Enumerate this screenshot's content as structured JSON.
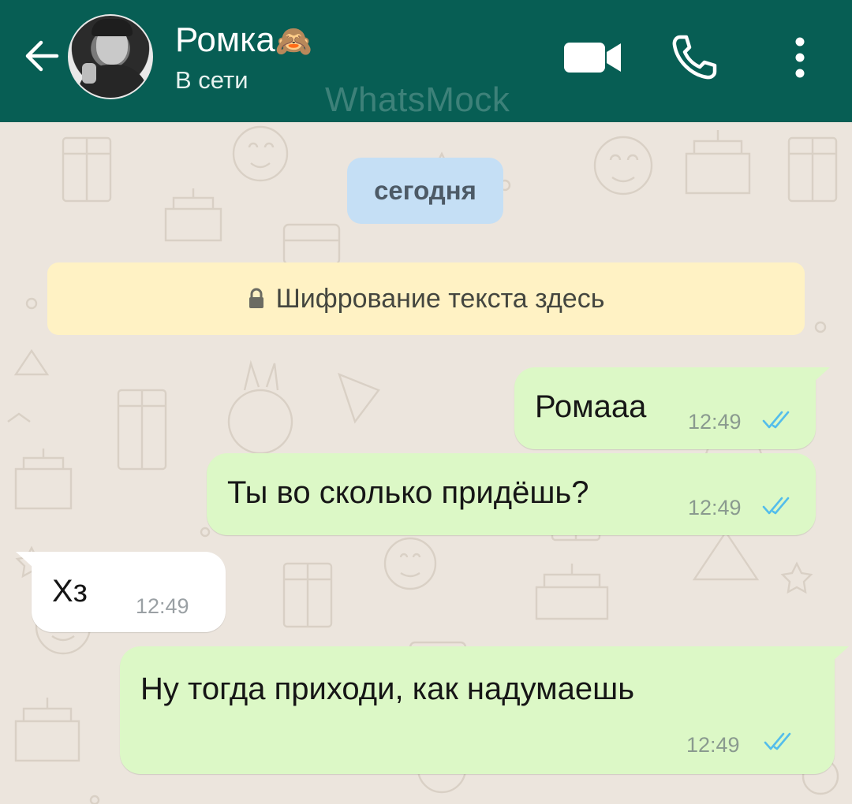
{
  "header": {
    "contact_name": "Ромка",
    "contact_emoji": "🙈",
    "status": "В сети",
    "watermark": "WhatsMock",
    "back_icon": "arrow-left-icon",
    "video_icon": "video-camera-icon",
    "call_icon": "phone-icon",
    "menu_icon": "more-vertical-icon"
  },
  "chat": {
    "date_divider": "сегодня",
    "encryption_notice": "Шифрование текста здесь",
    "messages": [
      {
        "direction": "outgoing",
        "text": "Ромааа",
        "time": "12:49",
        "status": "read"
      },
      {
        "direction": "outgoing",
        "text": "Ты во сколько придёшь?",
        "time": "12:49",
        "status": "read"
      },
      {
        "direction": "incoming",
        "text": "Хз",
        "time": "12:49"
      },
      {
        "direction": "outgoing",
        "text": "Ну тогда приходи, как надумаешь",
        "time": "12:49",
        "status": "read"
      }
    ]
  },
  "colors": {
    "header_bg": "#075e54",
    "chat_bg": "#ece5dd",
    "outgoing_bubble": "#dcf8c6",
    "incoming_bubble": "#ffffff",
    "read_ticks": "#53bdeb",
    "date_chip": "#c5dff5",
    "encryption_bg": "#fff2c4"
  }
}
